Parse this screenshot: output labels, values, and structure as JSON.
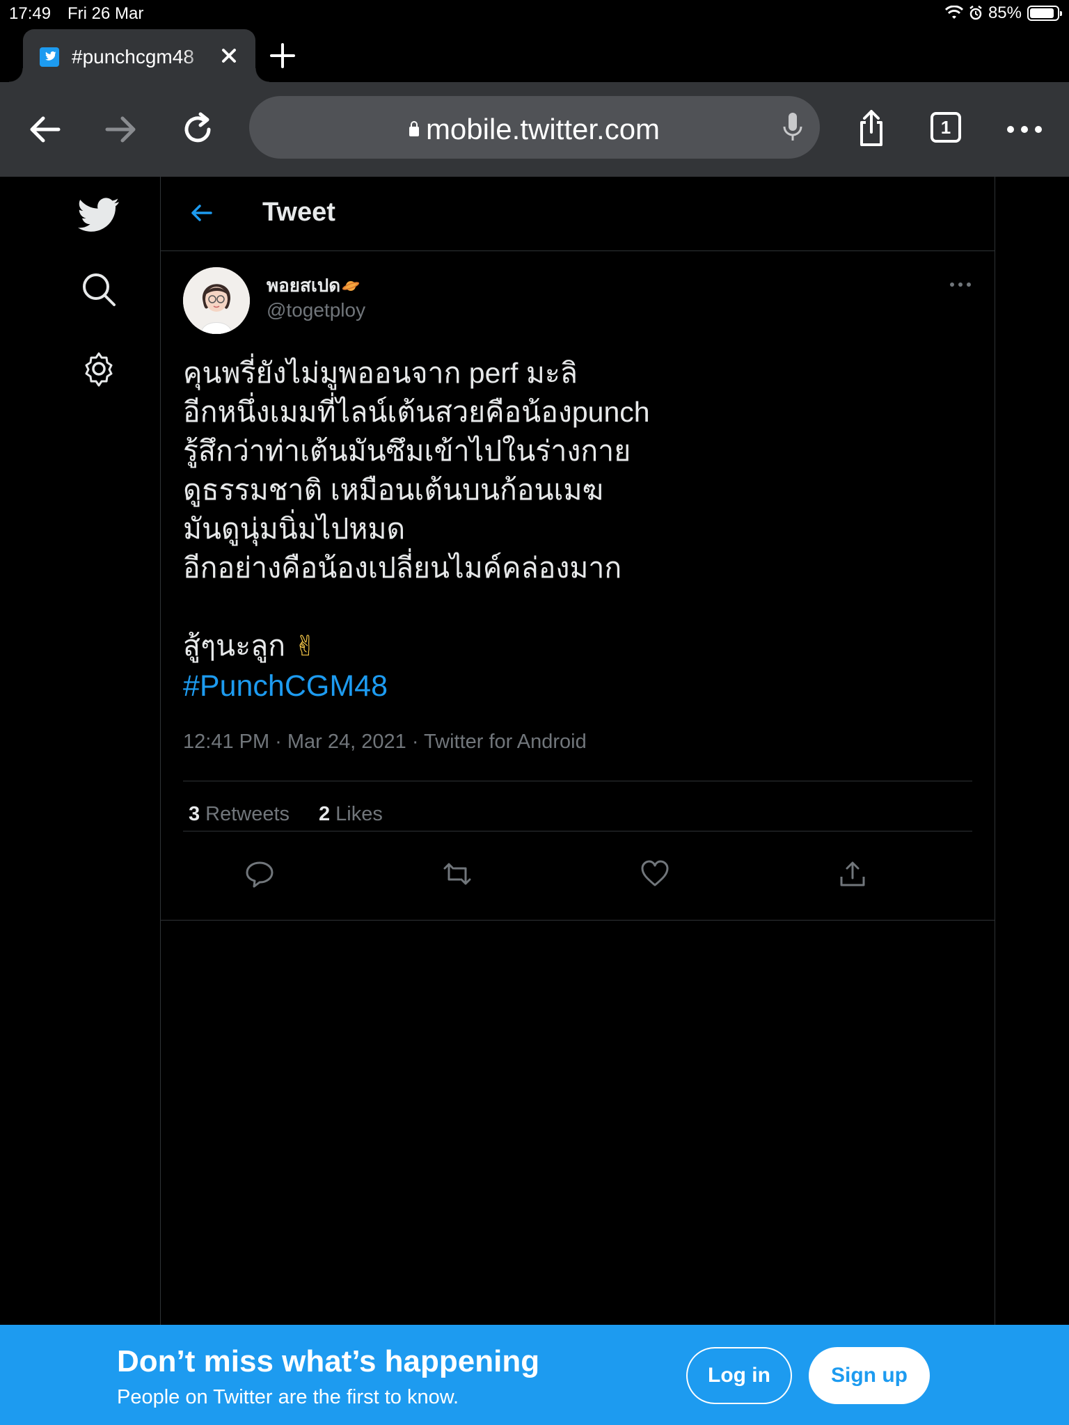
{
  "status_bar": {
    "time": "17:49",
    "date": "Fri 26 Mar",
    "battery": "85%",
    "battery_level": 0.85
  },
  "browser": {
    "tab": {
      "title": "#punchcgm48",
      "favicon": "twitter-icon"
    },
    "url": "mobile.twitter.com",
    "tab_count": "1"
  },
  "page": {
    "header_title": "Tweet",
    "tweet": {
      "author_name": "พอยสเปด",
      "author_handle": "@togetploy",
      "text_lines": "คุนพรี่ยังไม่มูพออนจาก perf มะลิ\nอีกหนึ่งเมมที่ไลน์เต้นสวยคือน้องpunch\nรู้สึกว่าท่าเต้นมันซึมเข้าไปในร่างกาย\nดูธรรมชาติ เหมือนเต้นบนก้อนเมฆ\nมันดูนุ่มนิ่มไปหมด\nอีกอย่างคือน้องเปลี่ยนไมค์คล่องมาก\n\nสู้ๆนะลูก",
      "emoji": "✌",
      "hashtag": "#PunchCGM48",
      "timestamp": "12:41 PM · Mar 24, 2021 · Twitter for Android",
      "retweets_count": "3",
      "retweets_label": "Retweets",
      "likes_count": "2",
      "likes_label": "Likes"
    }
  },
  "banner": {
    "headline": "Don’t miss what’s happening",
    "subtext": "People on Twitter are the first to know.",
    "login_label": "Log in",
    "signup_label": "Sign up"
  },
  "colors": {
    "accent": "#1d9bf0",
    "background": "#000000",
    "toolbar": "#333538"
  }
}
